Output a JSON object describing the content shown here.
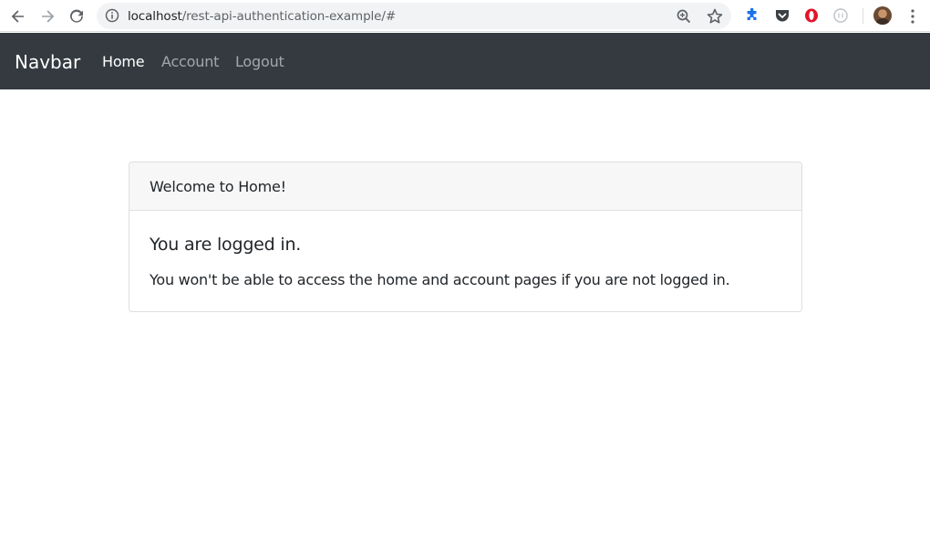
{
  "browser": {
    "url_host": "localhost",
    "url_path": "/rest-api-authentication-example/#",
    "icons": {
      "back": "arrow-left-icon",
      "forward": "arrow-right-icon",
      "reload": "reload-icon",
      "site_info": "info-icon",
      "zoom": "zoom-icon",
      "bookmark": "star-icon",
      "extension": "puzzle-icon",
      "pocket": "pocket-icon",
      "opera": "opera-icon",
      "extension_inactive": "circle-extension-icon",
      "profile": "avatar",
      "menu": "kebab-menu-icon"
    },
    "colors": {
      "puzzle": "#1a73e8",
      "opera": "#e0162b"
    }
  },
  "navbar": {
    "brand": "Navbar",
    "links": [
      {
        "label": "Home",
        "active": true
      },
      {
        "label": "Account",
        "active": false
      },
      {
        "label": "Logout",
        "active": false
      }
    ],
    "background": "#343a40"
  },
  "card": {
    "header": "Welcome to Home!",
    "title": "You are logged in.",
    "text": "You won't be able to access the home and account pages if you are not logged in."
  }
}
